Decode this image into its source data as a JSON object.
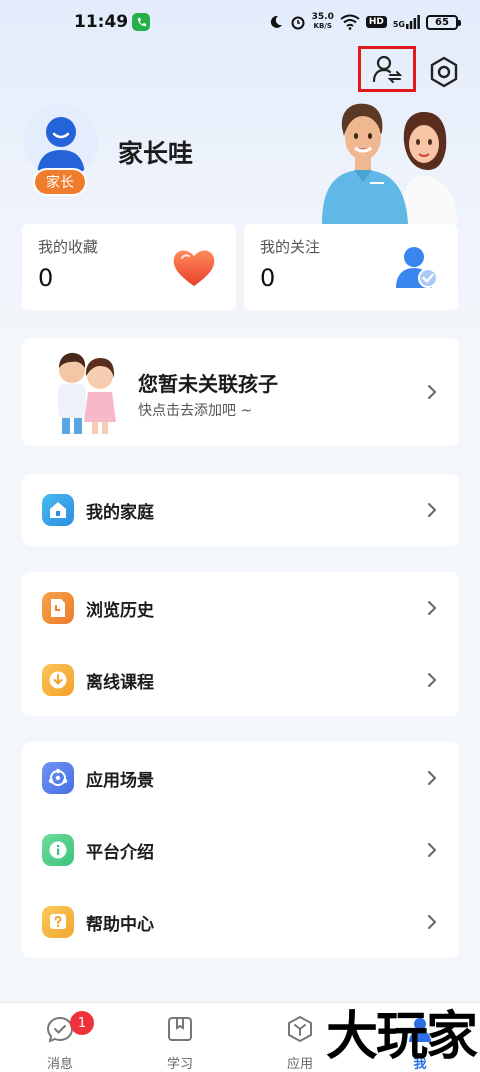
{
  "status_bar": {
    "time": "11:49",
    "net_speed_value": "35.0",
    "net_speed_unit": "KB/S",
    "hd": "HD",
    "network": "5G",
    "battery": "65"
  },
  "profile": {
    "name": "家长哇",
    "role": "家长"
  },
  "stats": {
    "favorites_label": "我的收藏",
    "favorites_value": "0",
    "follows_label": "我的关注",
    "follows_value": "0"
  },
  "child_link": {
    "title": "您暂未关联孩子",
    "subtitle": "快点击去添加吧 ~"
  },
  "menu": {
    "family": "我的家庭",
    "history": "浏览历史",
    "offline": "离线课程",
    "scenes": "应用场景",
    "platform": "平台介绍",
    "help": "帮助中心"
  },
  "nav": {
    "messages": "消息",
    "messages_badge": "1",
    "study": "学习",
    "apps": "应用",
    "me": "我"
  },
  "watermark": "大玩家",
  "colors": {
    "accent": "#2f6fe5",
    "highlight_box": "#e0191f",
    "role_badge": "#f07c2d"
  }
}
